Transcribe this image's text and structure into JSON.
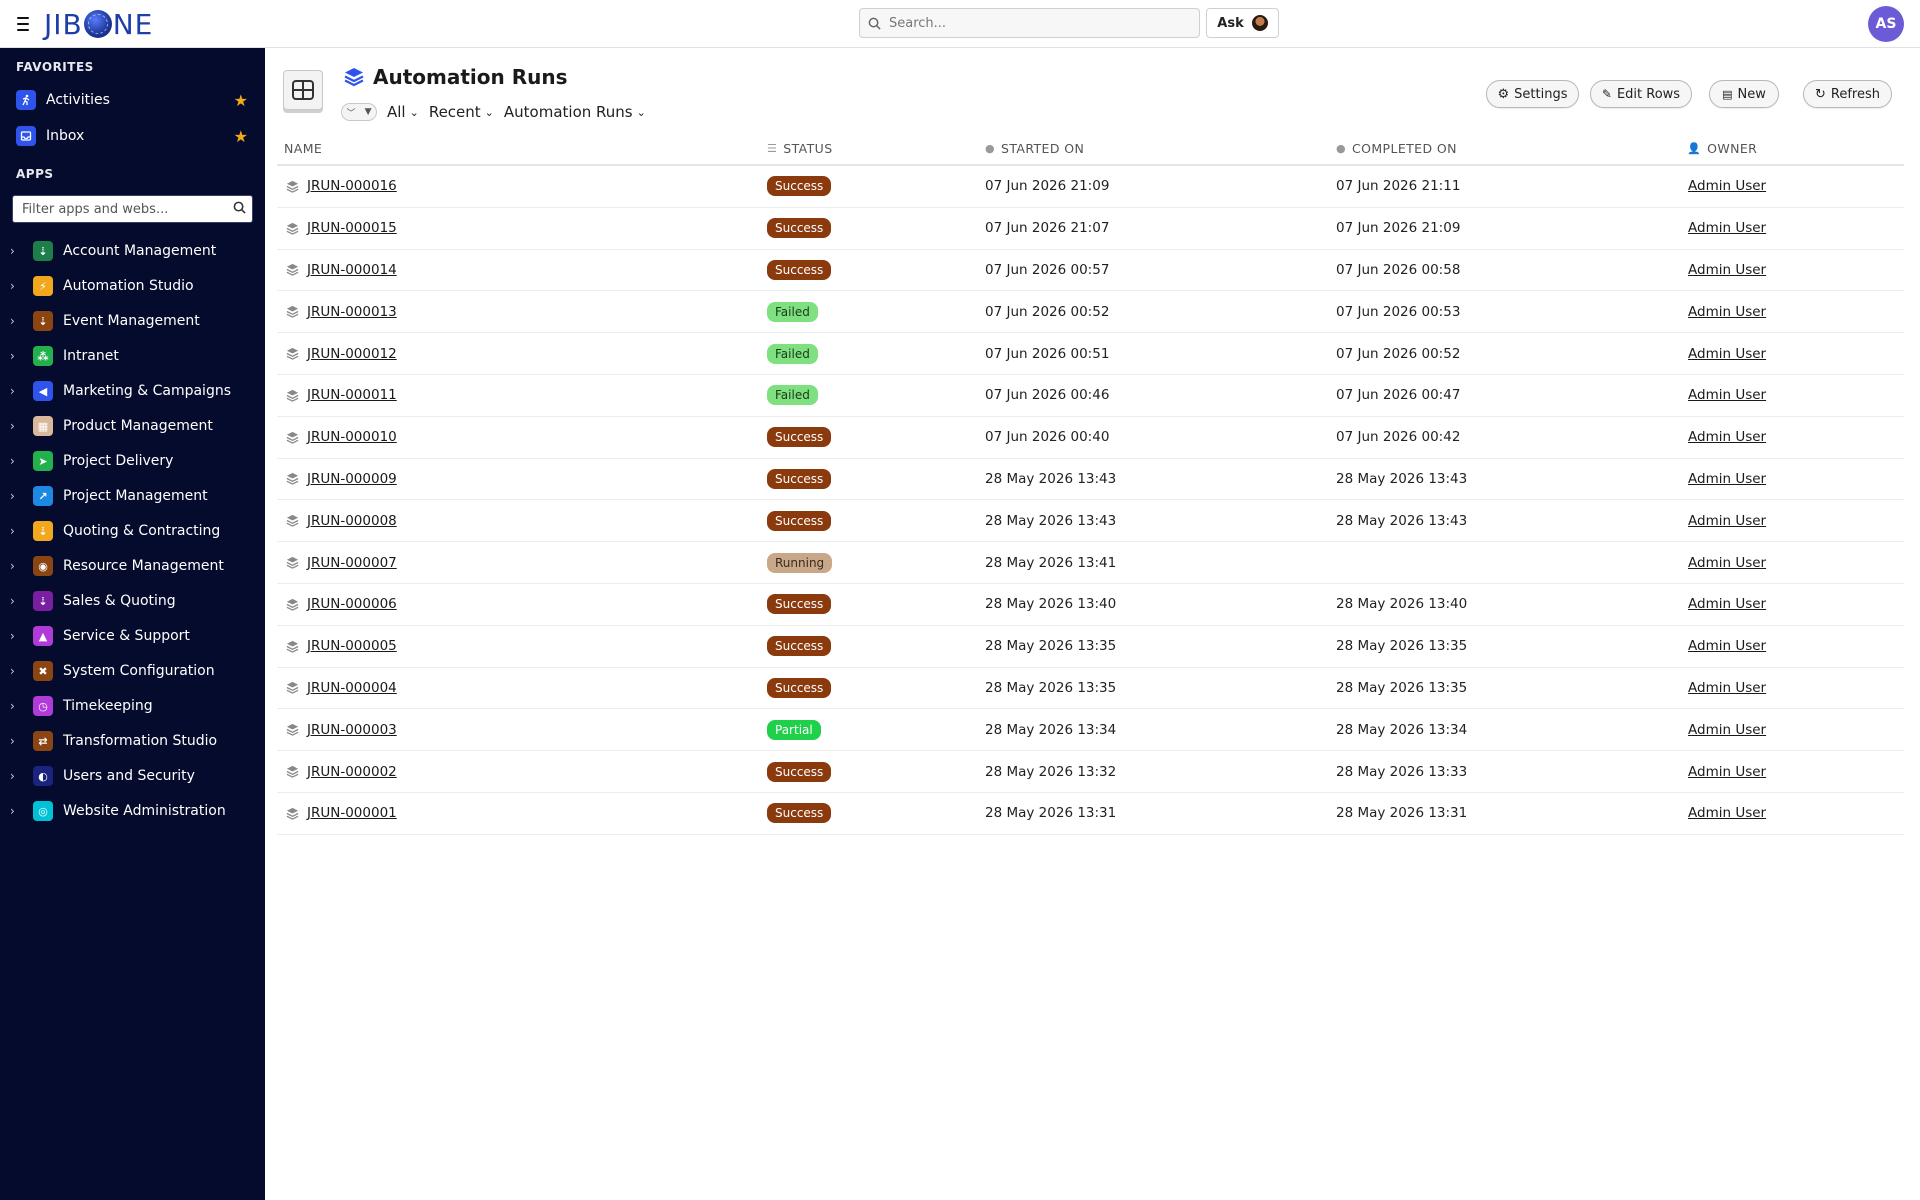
{
  "app": {
    "logo_left": "JIB",
    "logo_right": "NE",
    "search_placeholder": "Search...",
    "ask_label": "Ask",
    "user_initials": "AS"
  },
  "sidebar": {
    "favorites_heading": "FAVORITES",
    "favorites": [
      {
        "label": "Activities",
        "icon": "runner-icon",
        "color": "#2f54eb"
      },
      {
        "label": "Inbox",
        "icon": "inbox-icon",
        "color": "#2f54eb"
      }
    ],
    "apps_heading": "APPS",
    "filter_placeholder": "Filter apps and webs...",
    "apps": [
      {
        "label": "Account Management",
        "color": "#1e7e4a"
      },
      {
        "label": "Automation Studio",
        "color": "#f2a81d"
      },
      {
        "label": "Event Management",
        "color": "#8b4513"
      },
      {
        "label": "Intranet",
        "color": "#22b14c"
      },
      {
        "label": "Marketing & Campaigns",
        "color": "#2f54eb"
      },
      {
        "label": "Product Management",
        "color": "#d9b89c"
      },
      {
        "label": "Project Delivery",
        "color": "#22b14c"
      },
      {
        "label": "Project Management",
        "color": "#1e88e5"
      },
      {
        "label": "Quoting & Contracting",
        "color": "#f2a81d"
      },
      {
        "label": "Resource Management",
        "color": "#8b4513"
      },
      {
        "label": "Sales & Quoting",
        "color": "#7b1fa2"
      },
      {
        "label": "Service & Support",
        "color": "#b03bd8"
      },
      {
        "label": "System Configuration",
        "color": "#8b4513"
      },
      {
        "label": "Timekeeping",
        "color": "#b03bd8"
      },
      {
        "label": "Transformation Studio",
        "color": "#8b4513"
      },
      {
        "label": "Users and Security",
        "color": "#1a237e"
      },
      {
        "label": "Website Administration",
        "color": "#00c2d6"
      }
    ]
  },
  "page": {
    "title": "Automation Runs",
    "filters": {
      "scope": "All",
      "sort": "Recent",
      "view": "Automation Runs"
    },
    "buttons": {
      "settings": "Settings",
      "edit_rows": "Edit Rows",
      "new": "New",
      "refresh": "Refresh"
    }
  },
  "table": {
    "columns": {
      "name": "NAME",
      "status": "STATUS",
      "started": "STARTED ON",
      "completed": "COMPLETED ON",
      "owner": "OWNER"
    },
    "status_colors": {
      "Success": {
        "bg": "#8b3a0e",
        "fg": "#ffffff"
      },
      "Failed": {
        "bg": "#7ee07e",
        "fg": "#1a3a1a"
      },
      "Running": {
        "bg": "#c9a88a",
        "fg": "#3a2a1a"
      },
      "Partial": {
        "bg": "#1fd14a",
        "fg": "#ffffff"
      }
    },
    "rows": [
      {
        "id": "JRUN-000016",
        "status": "Success",
        "started": "07 Jun 2026 21:09",
        "completed": "07 Jun 2026 21:11",
        "owner": "Admin User"
      },
      {
        "id": "JRUN-000015",
        "status": "Success",
        "started": "07 Jun 2026 21:07",
        "completed": "07 Jun 2026 21:09",
        "owner": "Admin User"
      },
      {
        "id": "JRUN-000014",
        "status": "Success",
        "started": "07 Jun 2026 00:57",
        "completed": "07 Jun 2026 00:58",
        "owner": "Admin User"
      },
      {
        "id": "JRUN-000013",
        "status": "Failed",
        "started": "07 Jun 2026 00:52",
        "completed": "07 Jun 2026 00:53",
        "owner": "Admin User"
      },
      {
        "id": "JRUN-000012",
        "status": "Failed",
        "started": "07 Jun 2026 00:51",
        "completed": "07 Jun 2026 00:52",
        "owner": "Admin User"
      },
      {
        "id": "JRUN-000011",
        "status": "Failed",
        "started": "07 Jun 2026 00:46",
        "completed": "07 Jun 2026 00:47",
        "owner": "Admin User"
      },
      {
        "id": "JRUN-000010",
        "status": "Success",
        "started": "07 Jun 2026 00:40",
        "completed": "07 Jun 2026 00:42",
        "owner": "Admin User"
      },
      {
        "id": "JRUN-000009",
        "status": "Success",
        "started": "28 May 2026 13:43",
        "completed": "28 May 2026 13:43",
        "owner": "Admin User"
      },
      {
        "id": "JRUN-000008",
        "status": "Success",
        "started": "28 May 2026 13:43",
        "completed": "28 May 2026 13:43",
        "owner": "Admin User"
      },
      {
        "id": "JRUN-000007",
        "status": "Running",
        "started": "28 May 2026 13:41",
        "completed": "",
        "owner": "Admin User"
      },
      {
        "id": "JRUN-000006",
        "status": "Success",
        "started": "28 May 2026 13:40",
        "completed": "28 May 2026 13:40",
        "owner": "Admin User"
      },
      {
        "id": "JRUN-000005",
        "status": "Success",
        "started": "28 May 2026 13:35",
        "completed": "28 May 2026 13:35",
        "owner": "Admin User"
      },
      {
        "id": "JRUN-000004",
        "status": "Success",
        "started": "28 May 2026 13:35",
        "completed": "28 May 2026 13:35",
        "owner": "Admin User"
      },
      {
        "id": "JRUN-000003",
        "status": "Partial",
        "started": "28 May 2026 13:34",
        "completed": "28 May 2026 13:34",
        "owner": "Admin User"
      },
      {
        "id": "JRUN-000002",
        "status": "Success",
        "started": "28 May 2026 13:32",
        "completed": "28 May 2026 13:33",
        "owner": "Admin User"
      },
      {
        "id": "JRUN-000001",
        "status": "Success",
        "started": "28 May 2026 13:31",
        "completed": "28 May 2026 13:31",
        "owner": "Admin User"
      }
    ]
  }
}
